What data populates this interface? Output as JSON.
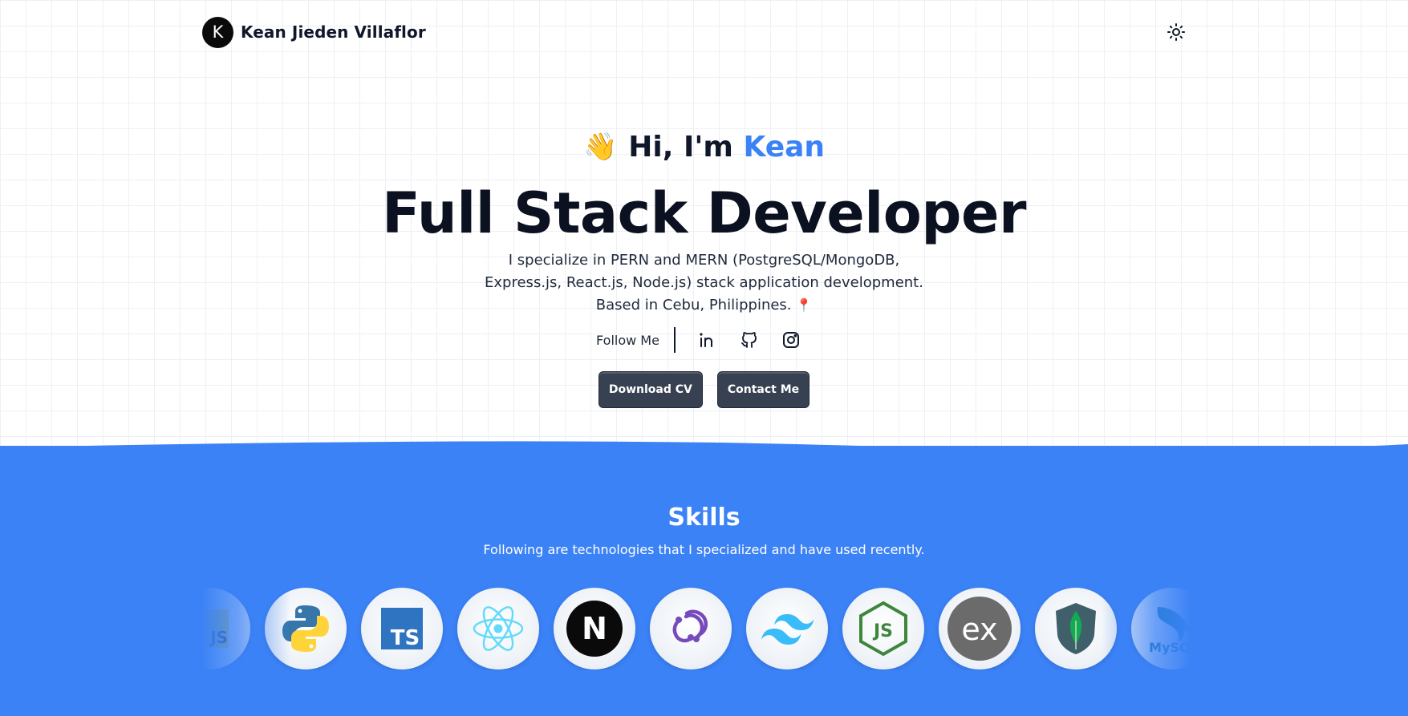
{
  "header": {
    "logo_letter": "K",
    "name": "Kean Jieden Villaflor",
    "theme_toggle_icon": "sun-icon"
  },
  "hero": {
    "greeting_emoji": "👋",
    "greeting_prefix": "Hi, I'm",
    "greeting_name": "Kean",
    "title": "Full Stack Developer",
    "description_line1": "I specialize in PERN and MERN (PostgreSQL/MongoDB,",
    "description_line2": "Express.js, React.js, Node.js) stack application development.",
    "description_line3": "Based in Cebu, Philippines.",
    "pin_emoji": "📍",
    "follow_label": "Follow Me",
    "social_icons": [
      "linkedin-icon",
      "github-icon",
      "instagram-icon"
    ],
    "download_cv_label": "Download CV",
    "contact_label": "Contact Me"
  },
  "skills": {
    "title": "Skills",
    "subtitle": "Following are technologies that I specialized and have used recently.",
    "items": [
      {
        "name": "javascript",
        "icon": "javascript-icon",
        "text": "JS"
      },
      {
        "name": "python",
        "icon": "python-icon"
      },
      {
        "name": "typescript",
        "icon": "typescript-icon",
        "text": "TS"
      },
      {
        "name": "react",
        "icon": "react-icon"
      },
      {
        "name": "nextjs",
        "icon": "nextjs-icon",
        "text": "N"
      },
      {
        "name": "redux",
        "icon": "redux-icon"
      },
      {
        "name": "tailwind",
        "icon": "tailwind-icon"
      },
      {
        "name": "nodejs",
        "icon": "nodejs-icon",
        "text": "JS"
      },
      {
        "name": "express",
        "icon": "express-icon",
        "text": "ex"
      },
      {
        "name": "mongodb",
        "icon": "mongodb-icon"
      },
      {
        "name": "mysql",
        "icon": "mysql-icon",
        "text": "MySQL"
      }
    ]
  },
  "colors": {
    "accent": "#3b82f6",
    "button_bg": "#374151",
    "nextjs_bg": "#0a0a0a",
    "typescript_bg": "#2f74c0",
    "nodejs_green": "#3c873a",
    "express_gray": "#6b6b6b",
    "mongodb_green": "#13aa52",
    "redux_purple": "#764abc",
    "tailwind_cyan": "#38bdf8"
  }
}
